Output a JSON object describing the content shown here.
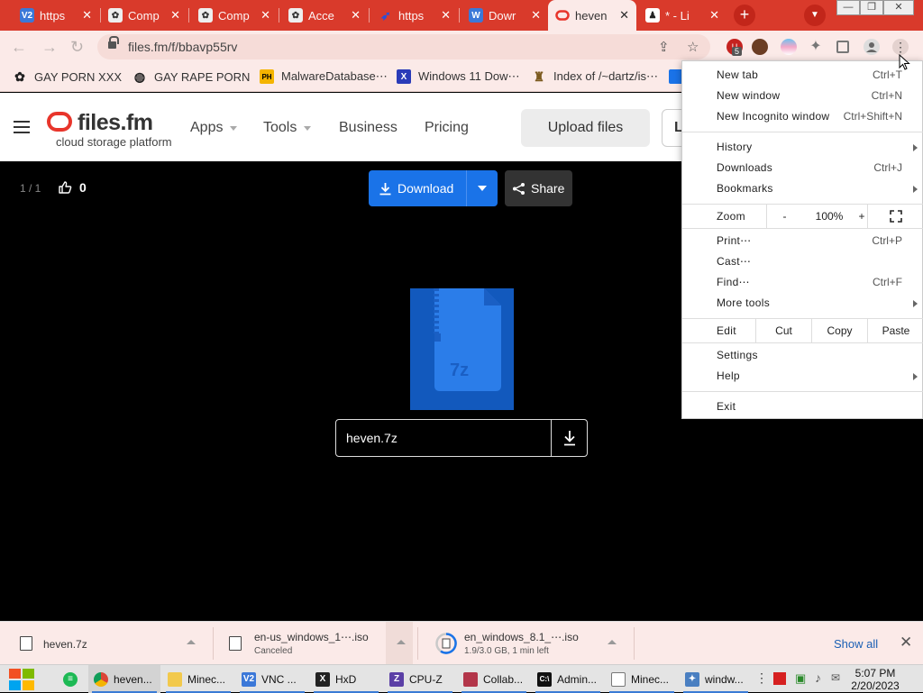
{
  "tabs": [
    {
      "title": "https",
      "icon": "vnc-icon"
    },
    {
      "title": "Comp",
      "icon": "badge-icon"
    },
    {
      "title": "Comp",
      "icon": "badge-icon"
    },
    {
      "title": "Acce",
      "icon": "badge-icon"
    },
    {
      "title": "https",
      "icon": "bird-icon"
    },
    {
      "title": "Dowr",
      "icon": "document-icon"
    },
    {
      "title": "heven",
      "icon": "files-fm-icon",
      "active": true
    },
    {
      "title": "* - Li",
      "icon": "person-icon"
    }
  ],
  "toolbar": {
    "url": "files.fm/f/bbavp55rv",
    "ext_badge": "5"
  },
  "bookmarks": [
    {
      "label": "GAY PORN XXX"
    },
    {
      "label": "GAY RAPE PORN"
    },
    {
      "label": "MalwareDatabase⋯"
    },
    {
      "label": "Windows 11 Dow⋯"
    },
    {
      "label": "Index of /~dartz/is⋯"
    }
  ],
  "site": {
    "logo_name": "files.fm",
    "logo_tagline": "cloud storage platform",
    "nav": [
      "Apps",
      "Tools",
      "Business",
      "Pricing"
    ],
    "upload_label": "Upload files",
    "login_label": "L"
  },
  "viewer": {
    "counter": "1 / 1",
    "likes": "0",
    "download_label": "Download",
    "share_label": "Share",
    "file_ext": "7z",
    "file_name": "heven.7z"
  },
  "menu": {
    "new_tab": {
      "label": "New tab",
      "shortcut": "Ctrl+T"
    },
    "new_window": {
      "label": "New window",
      "shortcut": "Ctrl+N"
    },
    "incognito": {
      "label": "New Incognito window",
      "shortcut": "Ctrl+Shift+N"
    },
    "history": {
      "label": "History"
    },
    "downloads": {
      "label": "Downloads",
      "shortcut": "Ctrl+J"
    },
    "bookmarks": {
      "label": "Bookmarks"
    },
    "zoom": {
      "label": "Zoom",
      "minus": "-",
      "value": "100%",
      "plus": "+"
    },
    "print": {
      "label": "Print⋯",
      "shortcut": "Ctrl+P"
    },
    "cast": {
      "label": "Cast⋯"
    },
    "find": {
      "label": "Find⋯",
      "shortcut": "Ctrl+F"
    },
    "more_tools": {
      "label": "More tools"
    },
    "edit": {
      "label": "Edit",
      "cut": "Cut",
      "copy": "Copy",
      "paste": "Paste"
    },
    "settings": {
      "label": "Settings"
    },
    "help": {
      "label": "Help"
    },
    "exit": {
      "label": "Exit"
    }
  },
  "downloads_bar": {
    "items": [
      {
        "name": "heven.7z",
        "status": ""
      },
      {
        "name": "en-us_windows_1⋯.iso",
        "status": "Canceled"
      },
      {
        "name": "en_windows_8.1_⋯.iso",
        "status": "1.9/3.0 GB, 1 min left"
      }
    ],
    "show_all": "Show all"
  },
  "taskbar": {
    "items": [
      {
        "label": "heven...",
        "icon": "chrome-icon"
      },
      {
        "label": "Minec...",
        "icon": "folder-icon"
      },
      {
        "label": "VNC ...",
        "icon": "vnc-icon"
      },
      {
        "label": "HxD",
        "icon": "hxd-icon"
      },
      {
        "label": "CPU-Z",
        "icon": "cpuz-icon"
      },
      {
        "label": "Collab...",
        "icon": "app-icon"
      },
      {
        "label": "Admin...",
        "icon": "terminal-icon"
      },
      {
        "label": "Minec...",
        "icon": "document-icon"
      },
      {
        "label": "windw...",
        "icon": "tool-icon"
      }
    ],
    "time": "5:07 PM",
    "date": "2/20/2023"
  },
  "colors": {
    "tab_strip": "#d93a2b",
    "toolbar": "#fbeae8",
    "download_button": "#1a73e8",
    "logo_red": "#e8352b",
    "file_thumb": "#1259bd"
  }
}
